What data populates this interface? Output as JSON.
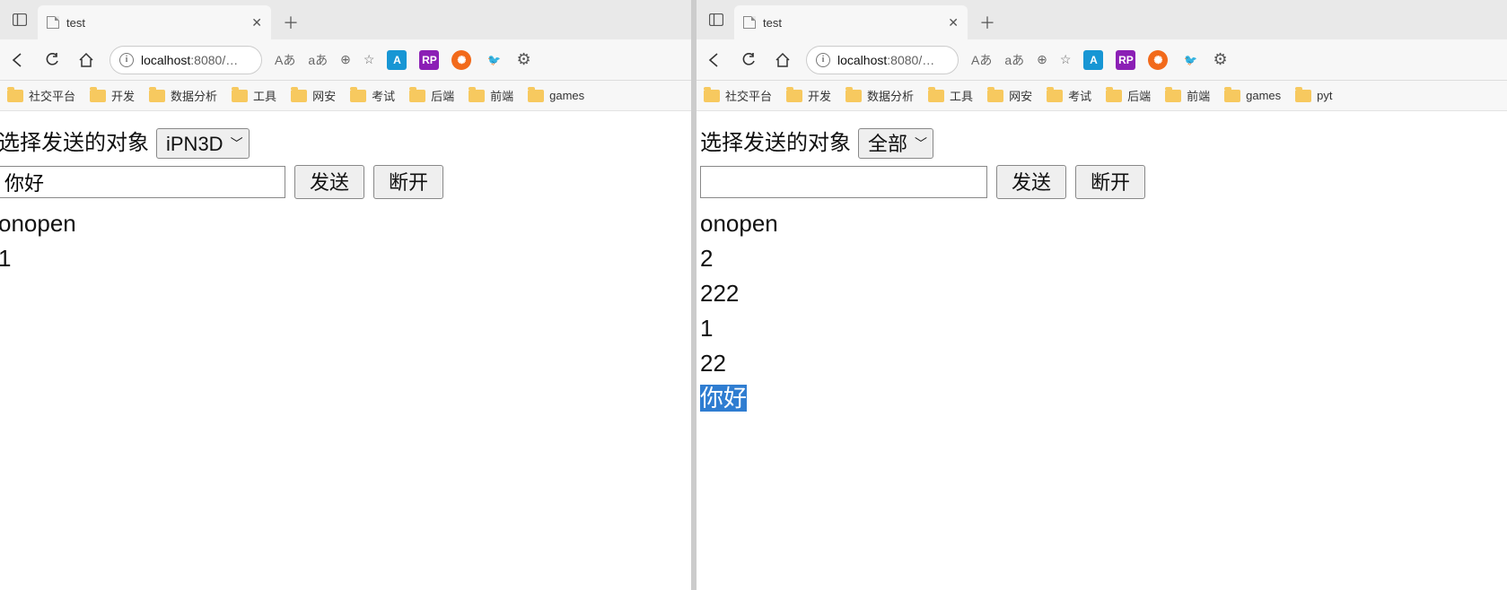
{
  "tab_title": "test",
  "url_host": "localhost",
  "url_port": ":8080",
  "url_rest": "/…",
  "toolbar_icons": {
    "read_aloud": "Aあ",
    "font": "aあ"
  },
  "bookmarks": [
    "社交平台",
    "开发",
    "数据分析",
    "工具",
    "网安",
    "考试",
    "后端",
    "前端",
    "games"
  ],
  "bookmarks_extra_right": "pyt",
  "ext_badges": [
    {
      "bg": "#1796d4",
      "txt": "A"
    },
    {
      "bg": "#8b1fb5",
      "txt": "RP"
    },
    {
      "bg": "#f26a1b",
      "txt": "✺"
    },
    {
      "bg": "#ffffff",
      "txt": "🐦"
    }
  ],
  "pageLabel": "选择发送的对象",
  "sendLabel": "发送",
  "disconnectLabel": "断开",
  "left": {
    "select_value": "iPN3D",
    "input_value": "你好",
    "log": [
      "onopen",
      "1"
    ]
  },
  "right": {
    "select_value": "全部",
    "input_value": "",
    "log": [
      "onopen",
      "2",
      "222",
      "1",
      "22"
    ],
    "log_selected": "你好"
  }
}
